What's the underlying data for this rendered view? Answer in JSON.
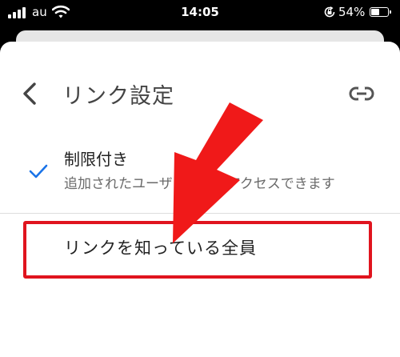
{
  "status_bar": {
    "carrier": "au",
    "time": "14:05",
    "battery_percent": "54%",
    "battery_level": 0.54
  },
  "header": {
    "title": "リンク設定"
  },
  "options": {
    "restricted_label": "制限付き",
    "restricted_desc": "追加されたユーザ　　　　アクセスできます",
    "anyone_label": "リンクを知っている全員"
  },
  "annotation": {
    "arrow_color": "#f01919",
    "highlight_color": "#e0141e"
  },
  "colors": {
    "check": "#1a73e8"
  }
}
